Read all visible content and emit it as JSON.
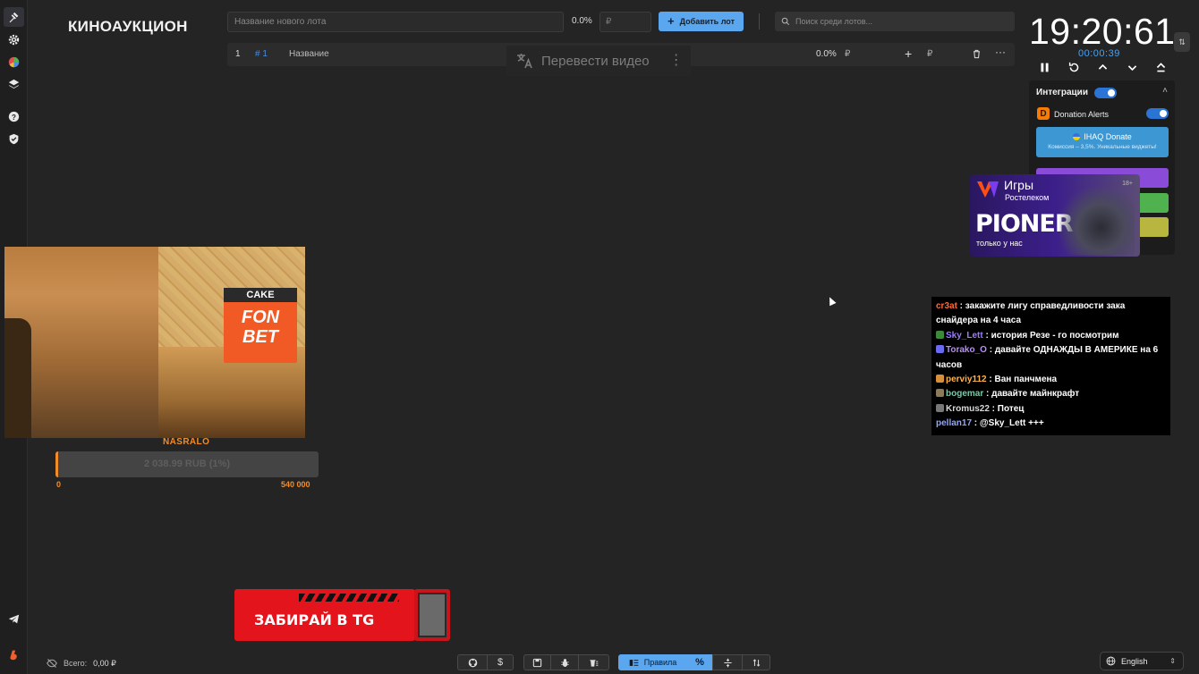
{
  "app": {
    "brand": "КИНОАУКЦИОН"
  },
  "toolbar": {
    "lot_placeholder": "Название нового лота",
    "percent": "0.0%",
    "price_placeholder": "₽",
    "add_lot_label": "Добавить лот",
    "search_placeholder": "Поиск среди лотов..."
  },
  "lots": [
    {
      "index": "1",
      "id": "# 1",
      "name": "Название",
      "percent": "0.0%",
      "currency": "₽",
      "currency_plus": "₽"
    }
  ],
  "overlay": {
    "translate_label": "Перевести видео"
  },
  "timer": {
    "main": "19:20:61",
    "elapsed": "00:00:39",
    "swap_label": "⇅"
  },
  "integrations": {
    "title": "Интеграции",
    "donation_alerts_label": "Donation Alerts",
    "donate_button": {
      "title": "IHAQ Donate",
      "subtitle": "Комиссия – 3,5%. Уникальные виджеты!"
    },
    "colors": {
      "purple": "#8a4bd8",
      "green": "#4fb24f",
      "olive": "#b9b63f"
    }
  },
  "ad": {
    "title": "Игры",
    "subtitle": "Ростелеком",
    "game": "PIONER",
    "tagline": "только у нас",
    "age": "18+"
  },
  "chat": [
    {
      "user": "cr3at",
      "color": "#ff6a3d",
      "text": "закажите лигу справедливости зака снайдера на 4 часа"
    },
    {
      "user": "Sky_Lett",
      "color": "#9b7bff",
      "text": "история Резе - го посмотрим"
    },
    {
      "user": "Torako_O",
      "color": "#b98cff",
      "text": "давайте ОДНАЖДЫ В АМЕРИКЕ на 6 часов"
    },
    {
      "user": "perviy112",
      "color": "#ffb347",
      "text": "Ван панчмена"
    },
    {
      "user": "bogemar",
      "color": "#7ec6a8",
      "text": "давайте майнкрафт"
    },
    {
      "user": "Kromus22",
      "color": "#d8d8d8",
      "text": "Потец"
    },
    {
      "user": "pellan17",
      "color": "#8fa8ff",
      "text": "@Sky_Lett +++"
    }
  ],
  "webcam": {
    "sign_top": "CAKE",
    "sign_main_1": "FON",
    "sign_main_2": "BET"
  },
  "goal": {
    "name": "NASRALO",
    "progress_text": "2 038.99 RUB (1%)",
    "progress_fraction": 0.01,
    "min": "0",
    "max": "540 000",
    "color": "#f28c28"
  },
  "promo": {
    "label": "ЗАБИРАЙ В TG"
  },
  "footer": {
    "total_label": "Всего:",
    "total_value": "0,00 ₽",
    "rules_label": "Правила",
    "percent_icon_label": "%",
    "language": "English"
  }
}
